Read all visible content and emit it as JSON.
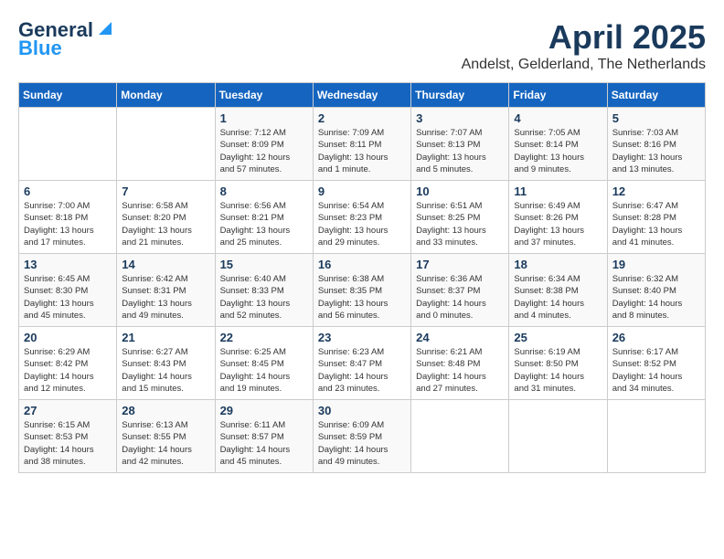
{
  "header": {
    "logo_line1": "General",
    "logo_line2": "Blue",
    "month_year": "April 2025",
    "location": "Andelst, Gelderland, The Netherlands"
  },
  "calendar": {
    "days_of_week": [
      "Sunday",
      "Monday",
      "Tuesday",
      "Wednesday",
      "Thursday",
      "Friday",
      "Saturday"
    ],
    "weeks": [
      [
        {
          "day": "",
          "info": ""
        },
        {
          "day": "",
          "info": ""
        },
        {
          "day": "1",
          "info": "Sunrise: 7:12 AM\nSunset: 8:09 PM\nDaylight: 12 hours\nand 57 minutes."
        },
        {
          "day": "2",
          "info": "Sunrise: 7:09 AM\nSunset: 8:11 PM\nDaylight: 13 hours\nand 1 minute."
        },
        {
          "day": "3",
          "info": "Sunrise: 7:07 AM\nSunset: 8:13 PM\nDaylight: 13 hours\nand 5 minutes."
        },
        {
          "day": "4",
          "info": "Sunrise: 7:05 AM\nSunset: 8:14 PM\nDaylight: 13 hours\nand 9 minutes."
        },
        {
          "day": "5",
          "info": "Sunrise: 7:03 AM\nSunset: 8:16 PM\nDaylight: 13 hours\nand 13 minutes."
        }
      ],
      [
        {
          "day": "6",
          "info": "Sunrise: 7:00 AM\nSunset: 8:18 PM\nDaylight: 13 hours\nand 17 minutes."
        },
        {
          "day": "7",
          "info": "Sunrise: 6:58 AM\nSunset: 8:20 PM\nDaylight: 13 hours\nand 21 minutes."
        },
        {
          "day": "8",
          "info": "Sunrise: 6:56 AM\nSunset: 8:21 PM\nDaylight: 13 hours\nand 25 minutes."
        },
        {
          "day": "9",
          "info": "Sunrise: 6:54 AM\nSunset: 8:23 PM\nDaylight: 13 hours\nand 29 minutes."
        },
        {
          "day": "10",
          "info": "Sunrise: 6:51 AM\nSunset: 8:25 PM\nDaylight: 13 hours\nand 33 minutes."
        },
        {
          "day": "11",
          "info": "Sunrise: 6:49 AM\nSunset: 8:26 PM\nDaylight: 13 hours\nand 37 minutes."
        },
        {
          "day": "12",
          "info": "Sunrise: 6:47 AM\nSunset: 8:28 PM\nDaylight: 13 hours\nand 41 minutes."
        }
      ],
      [
        {
          "day": "13",
          "info": "Sunrise: 6:45 AM\nSunset: 8:30 PM\nDaylight: 13 hours\nand 45 minutes."
        },
        {
          "day": "14",
          "info": "Sunrise: 6:42 AM\nSunset: 8:31 PM\nDaylight: 13 hours\nand 49 minutes."
        },
        {
          "day": "15",
          "info": "Sunrise: 6:40 AM\nSunset: 8:33 PM\nDaylight: 13 hours\nand 52 minutes."
        },
        {
          "day": "16",
          "info": "Sunrise: 6:38 AM\nSunset: 8:35 PM\nDaylight: 13 hours\nand 56 minutes."
        },
        {
          "day": "17",
          "info": "Sunrise: 6:36 AM\nSunset: 8:37 PM\nDaylight: 14 hours\nand 0 minutes."
        },
        {
          "day": "18",
          "info": "Sunrise: 6:34 AM\nSunset: 8:38 PM\nDaylight: 14 hours\nand 4 minutes."
        },
        {
          "day": "19",
          "info": "Sunrise: 6:32 AM\nSunset: 8:40 PM\nDaylight: 14 hours\nand 8 minutes."
        }
      ],
      [
        {
          "day": "20",
          "info": "Sunrise: 6:29 AM\nSunset: 8:42 PM\nDaylight: 14 hours\nand 12 minutes."
        },
        {
          "day": "21",
          "info": "Sunrise: 6:27 AM\nSunset: 8:43 PM\nDaylight: 14 hours\nand 15 minutes."
        },
        {
          "day": "22",
          "info": "Sunrise: 6:25 AM\nSunset: 8:45 PM\nDaylight: 14 hours\nand 19 minutes."
        },
        {
          "day": "23",
          "info": "Sunrise: 6:23 AM\nSunset: 8:47 PM\nDaylight: 14 hours\nand 23 minutes."
        },
        {
          "day": "24",
          "info": "Sunrise: 6:21 AM\nSunset: 8:48 PM\nDaylight: 14 hours\nand 27 minutes."
        },
        {
          "day": "25",
          "info": "Sunrise: 6:19 AM\nSunset: 8:50 PM\nDaylight: 14 hours\nand 31 minutes."
        },
        {
          "day": "26",
          "info": "Sunrise: 6:17 AM\nSunset: 8:52 PM\nDaylight: 14 hours\nand 34 minutes."
        }
      ],
      [
        {
          "day": "27",
          "info": "Sunrise: 6:15 AM\nSunset: 8:53 PM\nDaylight: 14 hours\nand 38 minutes."
        },
        {
          "day": "28",
          "info": "Sunrise: 6:13 AM\nSunset: 8:55 PM\nDaylight: 14 hours\nand 42 minutes."
        },
        {
          "day": "29",
          "info": "Sunrise: 6:11 AM\nSunset: 8:57 PM\nDaylight: 14 hours\nand 45 minutes."
        },
        {
          "day": "30",
          "info": "Sunrise: 6:09 AM\nSunset: 8:59 PM\nDaylight: 14 hours\nand 49 minutes."
        },
        {
          "day": "",
          "info": ""
        },
        {
          "day": "",
          "info": ""
        },
        {
          "day": "",
          "info": ""
        }
      ]
    ]
  }
}
